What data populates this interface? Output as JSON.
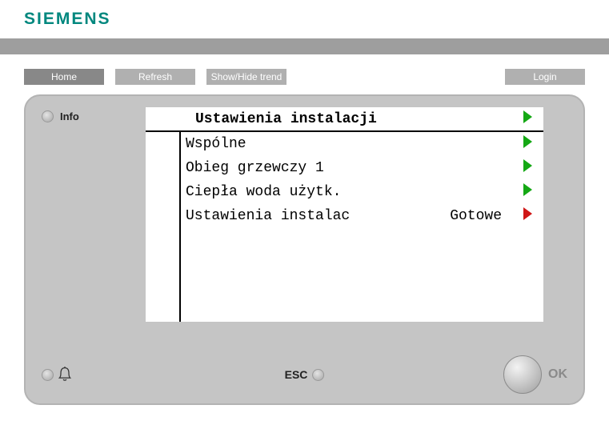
{
  "brand": "SIEMENS",
  "toolbar": {
    "home": "Home",
    "refresh": "Refresh",
    "trend": "Show/Hide trend",
    "login": "Login"
  },
  "panel": {
    "info_label": "Info",
    "title": "Ustawienia instalacji",
    "items": [
      {
        "label": "Wspólne",
        "value": "",
        "arrow": "green"
      },
      {
        "label": "Obieg grzewczy 1",
        "value": "",
        "arrow": "green"
      },
      {
        "label": "Ciepła woda użytk.",
        "value": "",
        "arrow": "green"
      },
      {
        "label": "Ustawienia instalac",
        "value": "Gotowe",
        "arrow": "red"
      }
    ],
    "esc": "ESC",
    "ok": "OK"
  }
}
